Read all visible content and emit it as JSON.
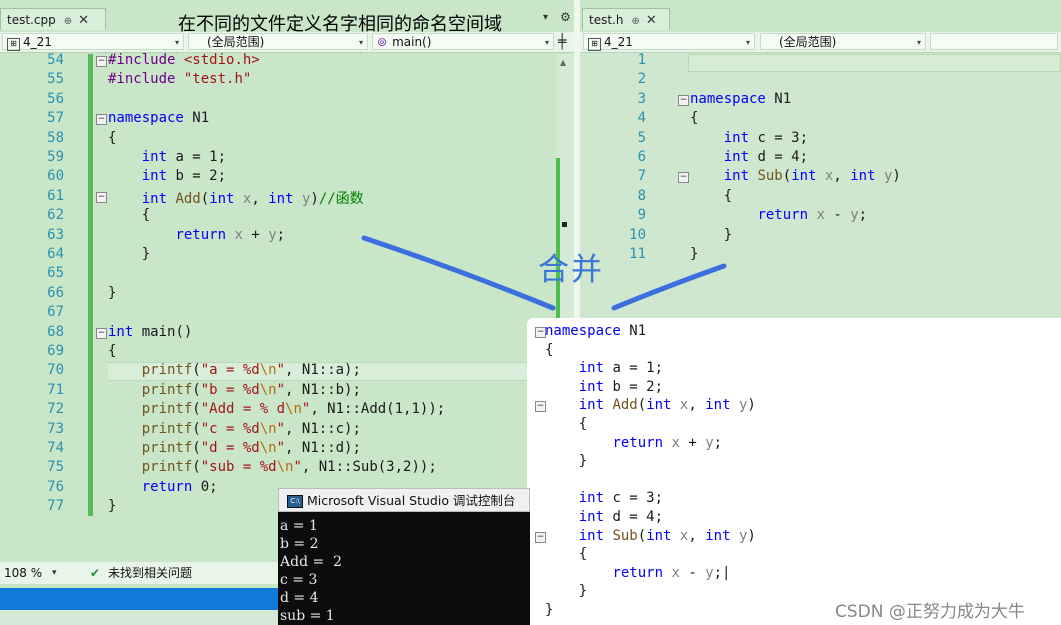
{
  "heading": "在不同的文件定义名字相同的命名空间域",
  "overlay_label": "合并",
  "watermark": "CSDN @正努力成为大牛",
  "left_editor": {
    "tab": {
      "label": "test.cpp",
      "pin": "⊕",
      "close": "✕"
    },
    "tab_actions": {
      "dropdown": "▾",
      "gear": "⚙"
    },
    "nav": {
      "project": "4_21",
      "scope": "(全局范围)",
      "member": "main()",
      "split": "╪"
    },
    "lines": [
      {
        "n": "54",
        "html": "<span class='mac'>#include</span> <span class='str'>&lt;stdio.h&gt;</span>",
        "fold": "−"
      },
      {
        "n": "55",
        "html": "<span class='mac'>#include</span> <span class='str'>\"test.h\"</span>"
      },
      {
        "n": "56",
        "html": ""
      },
      {
        "n": "57",
        "html": "<span class='kw'>namespace</span> N1",
        "fold": "−"
      },
      {
        "n": "58",
        "html": "{"
      },
      {
        "n": "59",
        "html": "    <span class='kw'>int</span> a = 1;"
      },
      {
        "n": "60",
        "html": "    <span class='kw'>int</span> b = 2;"
      },
      {
        "n": "61",
        "html": "    <span class='kw'>int</span> <span class='fn'>Add</span>(<span class='kw'>int</span> <span class='par'>x</span>, <span class='kw'>int</span> <span class='par'>y</span>)<span class='cm'>//函数</span>",
        "fold": "−"
      },
      {
        "n": "62",
        "html": "    {"
      },
      {
        "n": "63",
        "html": "        <span class='kw'>return</span> <span class='par'>x</span> + <span class='par'>y</span>;"
      },
      {
        "n": "64",
        "html": "    }"
      },
      {
        "n": "65",
        "html": ""
      },
      {
        "n": "66",
        "html": "}"
      },
      {
        "n": "67",
        "html": ""
      },
      {
        "n": "68",
        "html": "<span class='kw'>int</span> main()",
        "fold": "−"
      },
      {
        "n": "69",
        "html": "{"
      },
      {
        "n": "70",
        "html": "    <span class='fn'>printf</span>(<span class='str'>\"a = %d<span class='esc'>\\n</span>\"</span>, N1::a);"
      },
      {
        "n": "71",
        "html": "    <span class='fn'>printf</span>(<span class='str'>\"b = %d<span class='esc'>\\n</span>\"</span>, N1::b);"
      },
      {
        "n": "72",
        "html": "    <span class='fn'>printf</span>(<span class='str'>\"Add = % d<span class='esc'>\\n</span>\"</span>, N1::Add(1,1));"
      },
      {
        "n": "73",
        "html": "    <span class='fn'>printf</span>(<span class='str'>\"c = %d<span class='esc'>\\n</span>\"</span>, N1::c);"
      },
      {
        "n": "74",
        "html": "    <span class='fn'>printf</span>(<span class='str'>\"d = %d<span class='esc'>\\n</span>\"</span>, N1::d);"
      },
      {
        "n": "75",
        "html": "    <span class='fn'>printf</span>(<span class='str'>\"sub = %d<span class='esc'>\\n</span>\"</span>, N1::Sub(3,2));"
      },
      {
        "n": "76",
        "html": "    <span class='kw'>return</span> 0;"
      },
      {
        "n": "77",
        "html": "}"
      }
    ],
    "status": {
      "zoom": "108 %",
      "issues": "未找到相关问题"
    }
  },
  "right_editor": {
    "tab": {
      "label": "test.h",
      "pin": "⊕",
      "close": "✕"
    },
    "nav": {
      "project": "4_21",
      "scope": "(全局范围)"
    },
    "lines": [
      {
        "n": "1",
        "html": ""
      },
      {
        "n": "2",
        "html": ""
      },
      {
        "n": "3",
        "html": "<span class='kw'>namespace</span> N1",
        "fold": "−"
      },
      {
        "n": "4",
        "html": "{"
      },
      {
        "n": "5",
        "html": "    <span class='kw'>int</span> c = 3;"
      },
      {
        "n": "6",
        "html": "    <span class='kw'>int</span> d = 4;"
      },
      {
        "n": "7",
        "html": "    <span class='kw'>int</span> <span class='fn'>Sub</span>(<span class='kw'>int</span> <span class='par'>x</span>, <span class='kw'>int</span> <span class='par'>y</span>)",
        "fold": "−"
      },
      {
        "n": "8",
        "html": "    {"
      },
      {
        "n": "9",
        "html": "        <span class='kw'>return</span> <span class='par'>x</span> - <span class='par'>y</span>;"
      },
      {
        "n": "10",
        "html": "    }"
      },
      {
        "n": "11",
        "html": "}"
      }
    ]
  },
  "merged_code": [
    {
      "html": "<span class='kw'>namespace</span> N1",
      "fold": "−"
    },
    {
      "html": "{"
    },
    {
      "html": "    <span class='kw'>int</span> a = 1;"
    },
    {
      "html": "    <span class='kw'>int</span> b = 2;"
    },
    {
      "html": "    <span class='kw'>int</span> <span class='fn'>Add</span>(<span class='kw'>int</span> <span class='par'>x</span>, <span class='kw'>int</span> <span class='par'>y</span>)",
      "fold": "−"
    },
    {
      "html": "    {"
    },
    {
      "html": "        <span class='kw'>return</span> <span class='par'>x</span> + <span class='par'>y</span>;"
    },
    {
      "html": "    }"
    },
    {
      "html": ""
    },
    {
      "html": "    <span class='kw'>int</span> c = 3;"
    },
    {
      "html": "    <span class='kw'>int</span> d = 4;"
    },
    {
      "html": "    <span class='kw'>int</span> <span class='fn'>Sub</span>(<span class='kw'>int</span> <span class='par'>x</span>, <span class='kw'>int</span> <span class='par'>y</span>)",
      "fold": "−"
    },
    {
      "html": "    {"
    },
    {
      "html": "        <span class='kw'>return</span> <span class='par'>x</span> - <span class='par'>y</span>;|"
    },
    {
      "html": "    }"
    },
    {
      "html": "}"
    }
  ],
  "console": {
    "title": "Microsoft Visual Studio 调试控制台",
    "icon": "C:\\",
    "output": "a = 1\nb = 2\nAdd =  2\nc = 3\nd = 4\nsub = 1"
  }
}
